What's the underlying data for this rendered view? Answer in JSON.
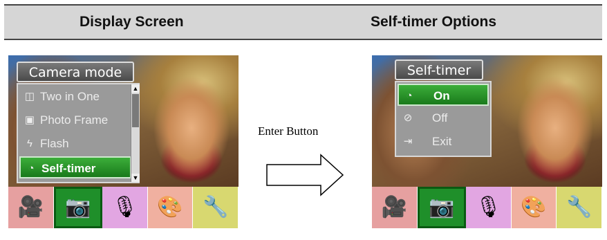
{
  "headers": {
    "left": "Display Screen",
    "right": "Self-timer Options"
  },
  "transition": {
    "label": "Enter Button"
  },
  "left_screen": {
    "menu_title": "Camera mode",
    "items": [
      {
        "label": "Two in One",
        "icon": "two-in-one-icon",
        "glyph": "◫"
      },
      {
        "label": "Photo Frame",
        "icon": "photo-frame-icon",
        "glyph": "▣"
      },
      {
        "label": "Flash",
        "icon": "flash-icon",
        "glyph": "ϟ"
      },
      {
        "label": "Self-timer",
        "icon": "self-timer-icon",
        "glyph": "◔",
        "selected": true
      }
    ],
    "scroll_position": 0.75
  },
  "right_screen": {
    "menu_title": "Self-timer",
    "items": [
      {
        "label": "On",
        "icon": "timer-on-icon",
        "glyph": "◔",
        "selected": true
      },
      {
        "label": "Off",
        "icon": "timer-off-icon",
        "glyph": "⊘"
      },
      {
        "label": "Exit",
        "icon": "exit-icon",
        "glyph": "⇥"
      }
    ]
  },
  "mode_tabs": [
    {
      "icon": "video-camera-icon",
      "color": "#e6a0a0",
      "glyph": "🎥"
    },
    {
      "icon": "camera-icon",
      "color": "#1f8f2a",
      "glyph": "📷",
      "active": true
    },
    {
      "icon": "microphone-icon",
      "color": "#e2a6e2",
      "glyph": "🎙"
    },
    {
      "icon": "palette-icon",
      "color": "#f0b0a0",
      "glyph": "🎨"
    },
    {
      "icon": "settings-tools-icon",
      "color": "#d8d870",
      "glyph": "🔧"
    }
  ]
}
